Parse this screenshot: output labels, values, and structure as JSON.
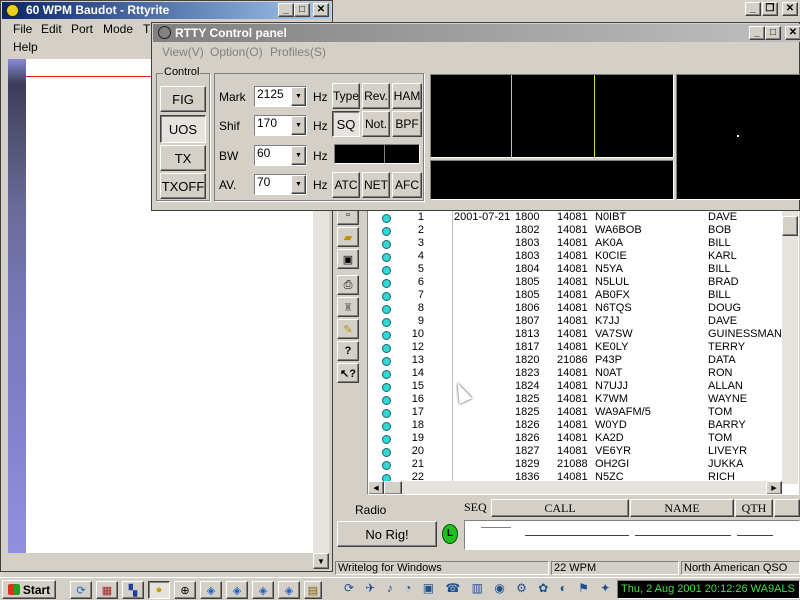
{
  "main_window": {
    "title": "60 WPM Baudot - Rttyrite",
    "menu": [
      "File",
      "Edit",
      "Port",
      "Mode",
      "TU",
      "Help"
    ]
  },
  "control_panel": {
    "title": "RTTY Control panel",
    "menu": [
      "View(V)",
      "Option(O)",
      "Profiles(S)"
    ],
    "group_label": "Control",
    "buttons": {
      "fig": "FIG",
      "uos": "UOS",
      "tx": "TX",
      "txoff": "TXOFF"
    },
    "mark": {
      "label": "Mark",
      "value": "2125",
      "unit": "Hz"
    },
    "shift": {
      "label": "Shif",
      "value": "170",
      "unit": "Hz"
    },
    "bw": {
      "label": "BW",
      "value": "60",
      "unit": "Hz"
    },
    "av": {
      "label": "AV.",
      "value": "70",
      "unit": "Hz"
    },
    "mode_buttons": {
      "type": "Type",
      "rev": "Rev.",
      "ham": "HAM",
      "sq": "SQ",
      "not": "Not.",
      "bpf": "BPF",
      "atc": "ATC",
      "net": "NET",
      "afc": "AFC"
    }
  },
  "log": {
    "rows": [
      {
        "num": "1",
        "date": "2001-07-21",
        "time": "1800",
        "freq": "14081",
        "call": "N0IBT",
        "name": "DAVE"
      },
      {
        "num": "2",
        "date": "",
        "time": "1802",
        "freq": "14081",
        "call": "WA6BOB",
        "name": "BOB"
      },
      {
        "num": "3",
        "date": "",
        "time": "1803",
        "freq": "14081",
        "call": "AK0A",
        "name": "BILL"
      },
      {
        "num": "4",
        "date": "",
        "time": "1803",
        "freq": "14081",
        "call": "K0CIE",
        "name": "KARL"
      },
      {
        "num": "5",
        "date": "",
        "time": "1804",
        "freq": "14081",
        "call": "N5YA",
        "name": "BILL"
      },
      {
        "num": "6",
        "date": "",
        "time": "1805",
        "freq": "14081",
        "call": "N5LUL",
        "name": "BRAD"
      },
      {
        "num": "7",
        "date": "",
        "time": "1805",
        "freq": "14081",
        "call": "AB0FX",
        "name": "BILL"
      },
      {
        "num": "8",
        "date": "",
        "time": "1806",
        "freq": "14081",
        "call": "N6TQS",
        "name": "DOUG"
      },
      {
        "num": "9",
        "date": "",
        "time": "1807",
        "freq": "14081",
        "call": "K7JJ",
        "name": "DAVE"
      },
      {
        "num": "10",
        "date": "",
        "time": "1813",
        "freq": "14081",
        "call": "VA7SW",
        "name": "GUINESSMAN"
      },
      {
        "num": "12",
        "date": "",
        "time": "1817",
        "freq": "14081",
        "call": "KE0LY",
        "name": "TERRY"
      },
      {
        "num": "13",
        "date": "",
        "time": "1820",
        "freq": "21086",
        "call": "P43P",
        "name": "DATA"
      },
      {
        "num": "14",
        "date": "",
        "time": "1823",
        "freq": "14081",
        "call": "N0AT",
        "name": "RON"
      },
      {
        "num": "15",
        "date": "",
        "time": "1824",
        "freq": "14081",
        "call": "N7UJJ",
        "name": "ALLAN"
      },
      {
        "num": "16",
        "date": "",
        "time": "1825",
        "freq": "14081",
        "call": "K7WM",
        "name": "WAYNE"
      },
      {
        "num": "17",
        "date": "",
        "time": "1825",
        "freq": "14081",
        "call": "WA9AFM/5",
        "name": "TOM"
      },
      {
        "num": "18",
        "date": "",
        "time": "1826",
        "freq": "14081",
        "call": "W0YD",
        "name": "BARRY"
      },
      {
        "num": "19",
        "date": "",
        "time": "1826",
        "freq": "14081",
        "call": "KA2D",
        "name": "TOM"
      },
      {
        "num": "20",
        "date": "",
        "time": "1827",
        "freq": "14081",
        "call": "VE6YR",
        "name": "LIVEYR"
      },
      {
        "num": "21",
        "date": "",
        "time": "1829",
        "freq": "21088",
        "call": "OH2GI",
        "name": "JUKKA"
      },
      {
        "num": "22",
        "date": "",
        "time": "1836",
        "freq": "14081",
        "call": "N5ZC",
        "name": "RICH"
      }
    ],
    "radio_label": "Radio",
    "no_rig": "No Rig!",
    "led": "L",
    "headers": {
      "seq": "SEQ",
      "call": "CALL",
      "name": "NAME",
      "qth": "QTH"
    },
    "status": {
      "app": "Writelog for Windows",
      "wpm": "22 WPM",
      "contest": "North American QSO"
    }
  },
  "taskbar": {
    "start": "Start",
    "clock": "Thu, 2 Aug 2001  20:12:26 WA9ALS"
  }
}
